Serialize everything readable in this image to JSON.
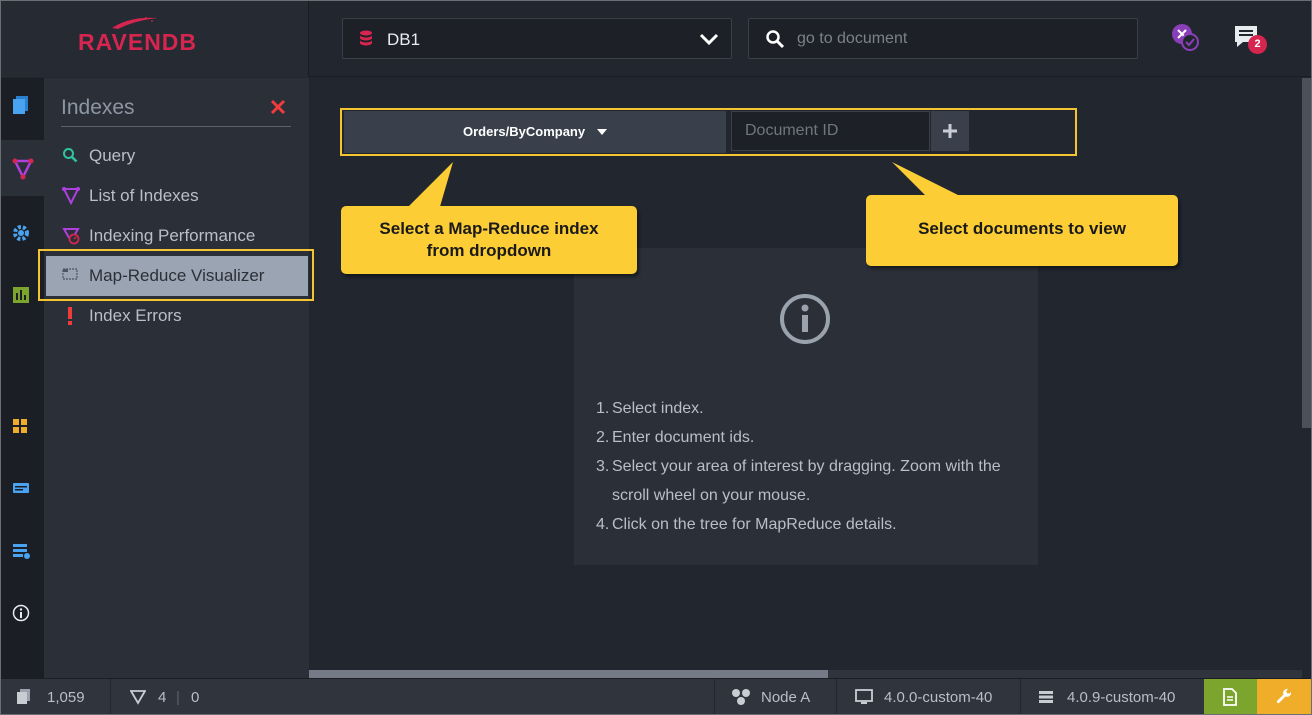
{
  "header": {
    "logo_text": "RAVENDB",
    "database": "DB1",
    "search_placeholder": "go to document",
    "notification_count": "2"
  },
  "sidebar": {
    "title": "Indexes",
    "items": [
      {
        "label": "Query",
        "icon": "search-icon"
      },
      {
        "label": "List of Indexes",
        "icon": "index-icon"
      },
      {
        "label": "Indexing Performance",
        "icon": "performance-icon"
      },
      {
        "label": "Map-Reduce Visualizer",
        "icon": "visualizer-icon",
        "active": true
      },
      {
        "label": "Index Errors",
        "icon": "exclamation-icon"
      }
    ]
  },
  "toolbar": {
    "selected_index": "Orders/ByCompany",
    "document_id_placeholder": "Document ID"
  },
  "callouts": {
    "index_line1": "Select  a Map-Reduce index",
    "index_line2": "from dropdown",
    "documents": "Select documents to view"
  },
  "info": {
    "steps": [
      {
        "num": "1.",
        "text": "Select index."
      },
      {
        "num": "2.",
        "text": "Enter document ids."
      },
      {
        "num": "3.",
        "text": "Select your area of interest by dragging. Zoom with the",
        "cont": "scroll wheel on your mouse."
      },
      {
        "num": "4.",
        "text": "Click on the tree for MapReduce details."
      }
    ]
  },
  "footer": {
    "documents_count": "1,059",
    "indexes_count": "4",
    "errors_count": "0",
    "node": "Node A",
    "client_version": "4.0.0-custom-40",
    "server_version": "4.0.9-custom-40"
  },
  "colors": {
    "accent": "#d6254f",
    "callout": "#fccd34",
    "highlight": "#f5c431",
    "sidebar_active": "#9ba4b2"
  }
}
